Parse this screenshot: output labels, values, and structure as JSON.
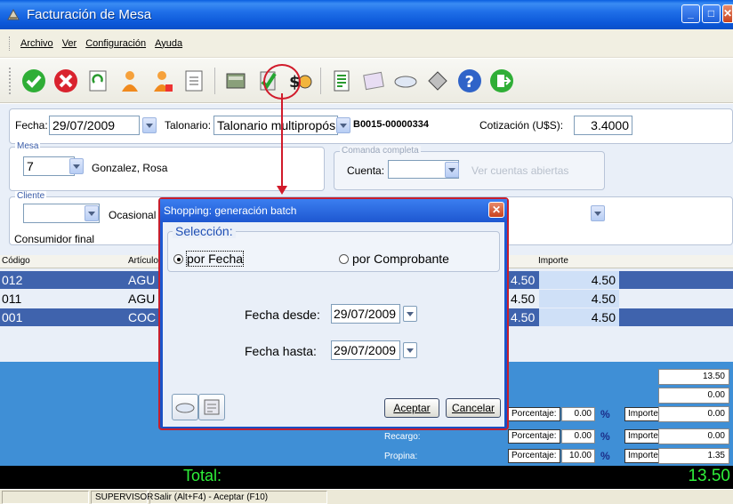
{
  "window": {
    "title": "Facturación de Mesa"
  },
  "menu": {
    "items": [
      "Archivo",
      "Ver",
      "Configuración",
      "Ayuda"
    ]
  },
  "header": {
    "fecha_label": "Fecha:",
    "fecha_value": "29/07/2009",
    "talonario_label": "Talonario:",
    "talonario_value": "Talonario multipropósito E",
    "comprobante": "B0015-00000334",
    "cotizacion_label": "Cotización (U$S):",
    "cotizacion_value": "3.4000"
  },
  "mesa": {
    "title": "Mesa",
    "numero": "7",
    "nombre": "Gonzalez, Rosa",
    "comanda_label": "Comanda completa",
    "cuenta_label": "Cuenta:",
    "cuenta_value": "",
    "ver_cuentas_label": "Ver cuentas abiertas"
  },
  "cliente": {
    "title": "Cliente",
    "value": "",
    "tipo": "Ocasional",
    "condicion": "Consumidor final"
  },
  "grid": {
    "headers": {
      "codigo": "Código",
      "articulo": "Artículo",
      "importe": "Importe"
    },
    "rows": [
      {
        "codigo": "012",
        "articulo": "AGU",
        "precio": "4.50",
        "importe": "4.50",
        "selected": true
      },
      {
        "codigo": "011",
        "articulo": "AGU",
        "precio": "4.50",
        "importe": "4.50",
        "selected": false
      },
      {
        "codigo": "001",
        "articulo": "COC",
        "precio": "4.50",
        "importe": "4.50",
        "selected": false
      }
    ]
  },
  "totals": {
    "subtotal": "13.50",
    "descuento_total": "0.00",
    "descuento": {
      "porcentaje_label": "Porcentaje:",
      "porcentaje": "0.00",
      "pct": "%",
      "importe_label": "Importe:",
      "importe": "0.00"
    },
    "recargo": {
      "label": "Recargo:",
      "porcentaje_label": "Porcentaje:",
      "porcentaje": "0.00",
      "pct": "%",
      "importe_label": "Importe:",
      "importe": "0.00"
    },
    "propina": {
      "label": "Propina:",
      "porcentaje_label": "Porcentaje:",
      "porcentaje": "10.00",
      "pct": "%",
      "importe_label": "Importe:",
      "importe": "1.35"
    },
    "total_label": "Total:",
    "total_value": "13.50"
  },
  "status": {
    "user": "SUPERVISOR",
    "hint": "Salir (Alt+F4) - Aceptar (F10)"
  },
  "dialog": {
    "title": "Shopping: generación batch",
    "seleccion_label": "Selección:",
    "radio_fecha": "por Fecha",
    "radio_comprobante": "por Comprobante",
    "desde_label": "Fecha desde:",
    "desde_value": "29/07/2009",
    "hasta_label": "Fecha hasta:",
    "hasta_value": "29/07/2009",
    "aceptar": "Aceptar",
    "cancelar": "Cancelar"
  },
  "colors": {
    "accent": "#3f63ad",
    "total_green": "#2ff03a",
    "highlight_red": "#d11a2a"
  }
}
